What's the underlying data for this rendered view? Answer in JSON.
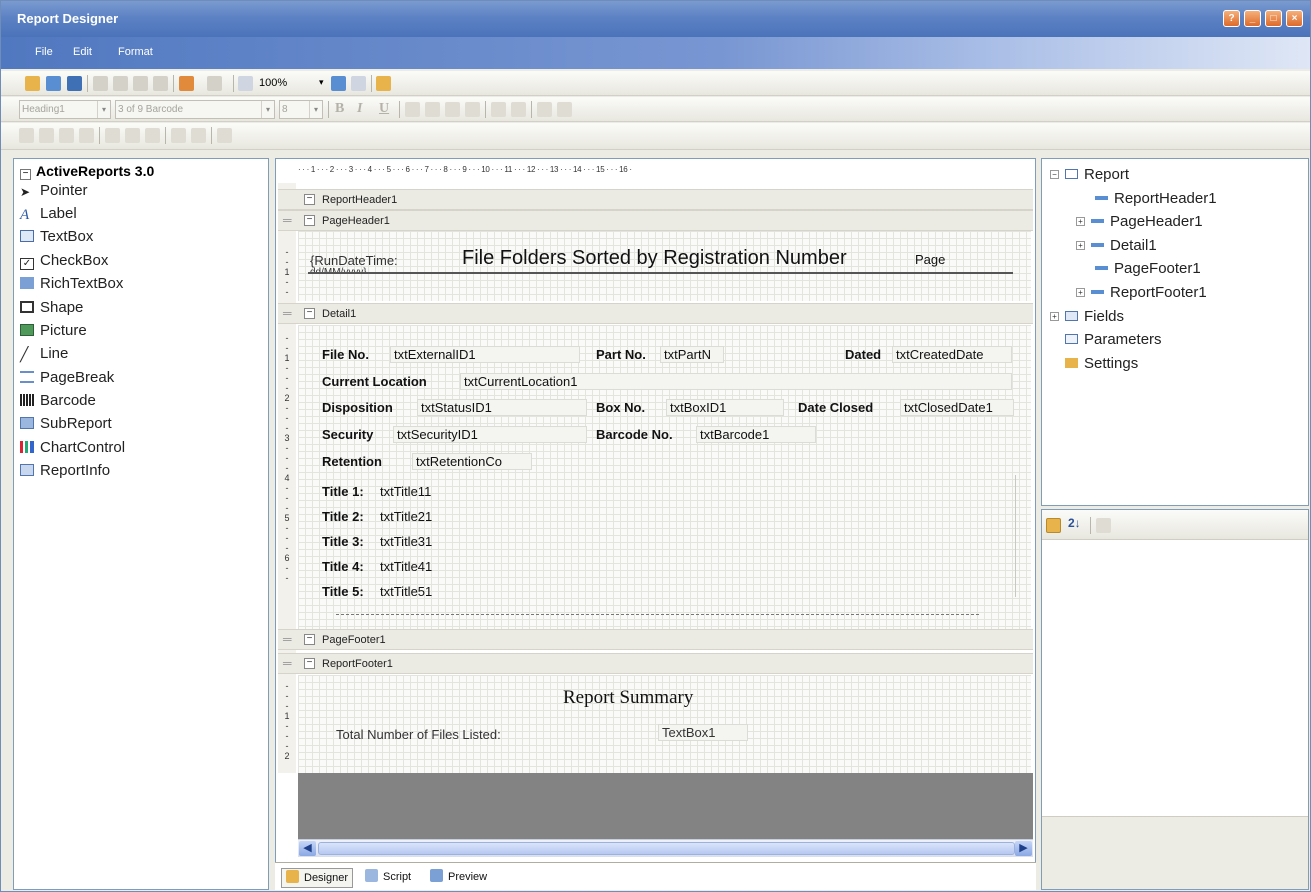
{
  "window": {
    "title": "Report Designer",
    "buttons": [
      "?",
      "_",
      "□",
      "×"
    ]
  },
  "menu": [
    "File",
    "Edit",
    "Format"
  ],
  "toolbar1": {
    "zoom": "100%"
  },
  "toolbar2": {
    "style_combo": "Heading1",
    "font_combo": "3 of 9 Barcode",
    "size_combo": "8",
    "bold": "B",
    "italic": "I",
    "underline": "U"
  },
  "toolbox": {
    "header": "ActiveReports 3.0",
    "items": [
      {
        "label": "Pointer",
        "icon": "pointer-icon"
      },
      {
        "label": "Label",
        "icon": "label-icon"
      },
      {
        "label": "TextBox",
        "icon": "textbox-icon"
      },
      {
        "label": "CheckBox",
        "icon": "checkbox-icon"
      },
      {
        "label": "RichTextBox",
        "icon": "richtextbox-icon"
      },
      {
        "label": "Shape",
        "icon": "shape-icon"
      },
      {
        "label": "Picture",
        "icon": "picture-icon"
      },
      {
        "label": "Line",
        "icon": "line-icon"
      },
      {
        "label": "PageBreak",
        "icon": "pagebreak-icon"
      },
      {
        "label": "Barcode",
        "icon": "barcode-icon"
      },
      {
        "label": "SubReport",
        "icon": "subreport-icon"
      },
      {
        "label": "ChartControl",
        "icon": "chart-icon"
      },
      {
        "label": "ReportInfo",
        "icon": "reportinfo-icon"
      }
    ]
  },
  "designer": {
    "ruler": "· · · 1 · · · 2 · · · 3 · · · 4 · · · 5 · · · 6 · · · 7 · · · 8 · · · 9 · · · 10 · · · 11 · · · 12 · · · 13 · · · 14 · · · 15 · · · 16 ·",
    "bands": {
      "report_header": "ReportHeader1",
      "page_header": "PageHeader1",
      "detail": "Detail1",
      "page_footer": "PageFooter1",
      "report_footer": "ReportFooter1"
    },
    "page_header": {
      "run_date": "{RunDateTime:",
      "run_date_2": "dd/MM/yyyy}",
      "title": "File Folders Sorted by Registration Number",
      "page": "Page"
    },
    "detail": {
      "file_no_label": "File No.",
      "file_no_value": "txtExternalID1",
      "part_no_label": "Part No.",
      "part_no_value": "txtPartN",
      "dated_label": "Dated",
      "dated_value": "txtCreatedDate",
      "location_label": "Current Location",
      "location_value": "txtCurrentLocation1",
      "disposition_label": "Disposition",
      "disposition_value": "txtStatusID1",
      "box_no_label": "Box No.",
      "box_no_value": "txtBoxID1",
      "date_closed_label": "Date Closed",
      "date_closed_value": "txtClosedDate1",
      "security_label": "Security",
      "security_value": "txtSecurityID1",
      "barcode_label": "Barcode No.",
      "barcode_value": "txtBarcode1",
      "retention_label": "Retention",
      "retention_value": "txtRetentionCo",
      "titles": [
        {
          "label": "Title 1:",
          "value": "txtTitle11"
        },
        {
          "label": "Title 2:",
          "value": "txtTitle21"
        },
        {
          "label": "Title 3:",
          "value": "txtTitle31"
        },
        {
          "label": "Title 4:",
          "value": "txtTitle41"
        },
        {
          "label": "Title 5:",
          "value": "txtTitle51"
        }
      ]
    },
    "report_footer": {
      "summary_title": "Report Summary",
      "total_label": "Total Number of Files Listed:",
      "total_value": "TextBox1"
    }
  },
  "tabs": [
    "Designer",
    "Script",
    "Preview"
  ],
  "explorer": {
    "root": "Report",
    "children": [
      "ReportHeader1",
      "PageHeader1",
      "Detail1",
      "PageFooter1",
      "ReportFooter1"
    ],
    "fields": "Fields",
    "parameters": "Parameters",
    "settings": "Settings"
  },
  "colors": {
    "title_bar": "#5d82c4",
    "panel_border": "#7f9db9",
    "band": "#ecebe3",
    "dark_area": "#838383"
  }
}
